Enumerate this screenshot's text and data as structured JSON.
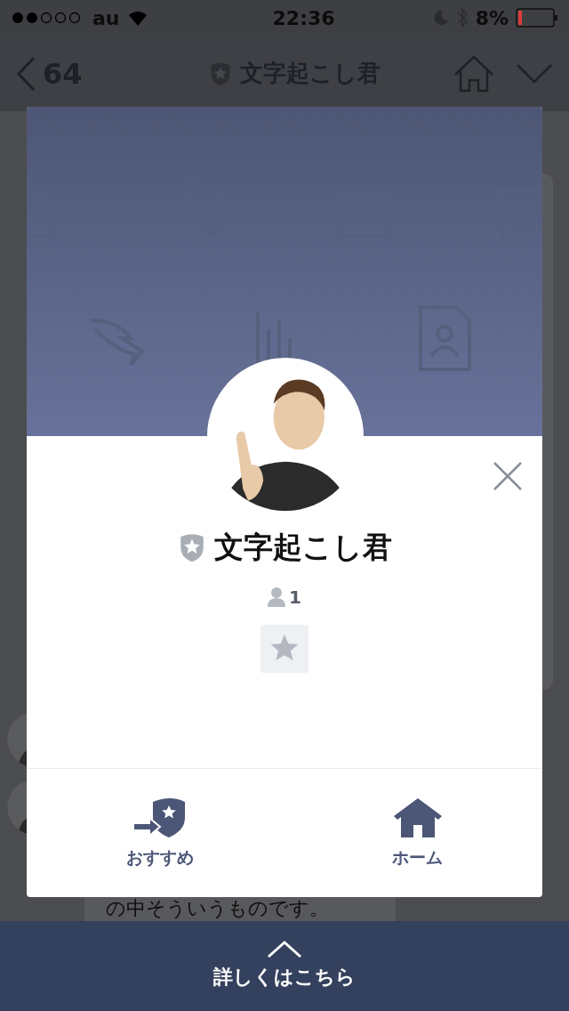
{
  "status_bar": {
    "carrier": "au",
    "time": "22:36",
    "battery": "8%"
  },
  "nav": {
    "back_count": "64",
    "title": "文字起こし君"
  },
  "chat": {
    "message_text": "の中そういうものです。"
  },
  "modal": {
    "name": "文字起こし君",
    "member_count": "1",
    "actions": [
      {
        "label": "おすすめ",
        "kind": "recommend"
      },
      {
        "label": "ホーム",
        "kind": "home"
      }
    ]
  },
  "footer": {
    "label": "詳しくはこちら"
  }
}
